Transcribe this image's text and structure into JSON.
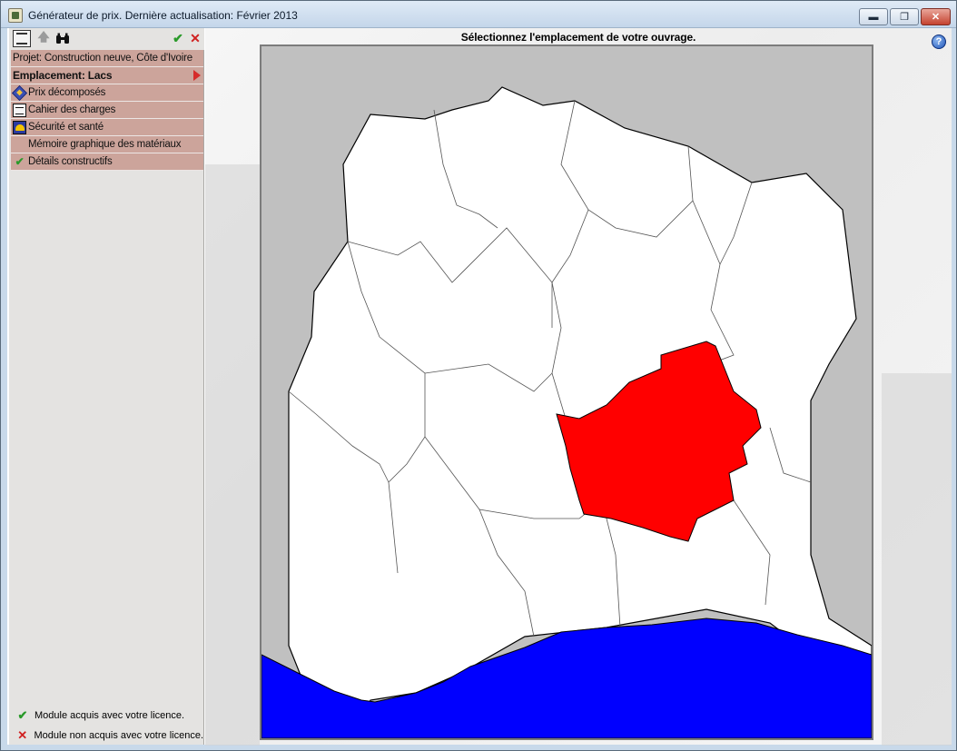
{
  "window": {
    "title": "Générateur de prix. Dernière actualisation: Février 2013",
    "min_glyph": "▬",
    "max_glyph": "❐",
    "close_glyph": "✕"
  },
  "toolbar": {
    "properties_icon": "properties-icon",
    "up_glyph": "🡅",
    "find_glyph": "⛶",
    "ok_glyph": "✔",
    "cancel_glyph": "✕"
  },
  "sidebar": {
    "project_label": "Projet: Construction neuve, Côte d'Ivoire",
    "location_label": "Emplacement: Lacs",
    "items": [
      {
        "label": "Prix décomposés",
        "icon": "price-breakdown-icon"
      },
      {
        "label": "Cahier des charges",
        "icon": "specifications-icon"
      },
      {
        "label": "Sécurité et santé",
        "icon": "safety-helmet-icon"
      },
      {
        "label": "Mémoire graphique des matériaux",
        "icon": ""
      },
      {
        "label": "Détails constructifs",
        "icon": "check-icon"
      }
    ],
    "check_glyph": "✔"
  },
  "legend": {
    "acquired_glyph": "✔",
    "acquired_label": "Module acquis avec votre licence.",
    "not_acquired_glyph": "✕",
    "not_acquired_label": "Module non acquis avec votre licence."
  },
  "content": {
    "title": "Sélectionnez l'emplacement de votre ouvrage.",
    "help_glyph": "?"
  },
  "map": {
    "selected_region": "Lacs",
    "colors": {
      "background": "#c0c0c0",
      "land": "#ffffff",
      "selected": "#ff0000",
      "sea": "#0000ff",
      "border": "#000000"
    }
  }
}
